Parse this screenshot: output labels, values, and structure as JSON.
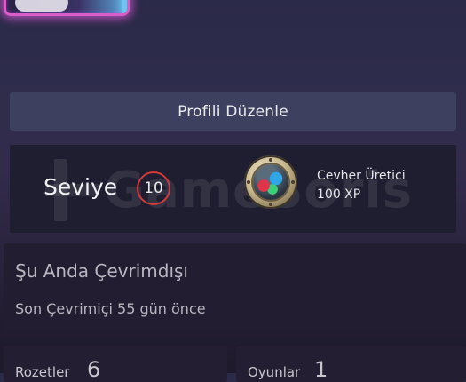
{
  "profile": {
    "edit_button_label": "Profili Düzenle"
  },
  "level": {
    "label": "Seviye",
    "value": "10",
    "badge_color": "#d33a3a"
  },
  "badge": {
    "icon": "ore-extractor-badge-icon",
    "name": "Cevher Üretici",
    "xp": "100 XP"
  },
  "watermark": {
    "text": "GameSoris"
  },
  "status": {
    "title": "Şu Anda Çevrimdışı",
    "last_online": "Son Çevrimiçi 55 gün önce"
  },
  "stats": [
    {
      "label": "Rozetler",
      "value": "6"
    },
    {
      "label": "Oyunlar",
      "value": "1"
    }
  ],
  "colors": {
    "avatar_frame_glow": "#d95ec8",
    "panel_background": "#1f1e30"
  }
}
